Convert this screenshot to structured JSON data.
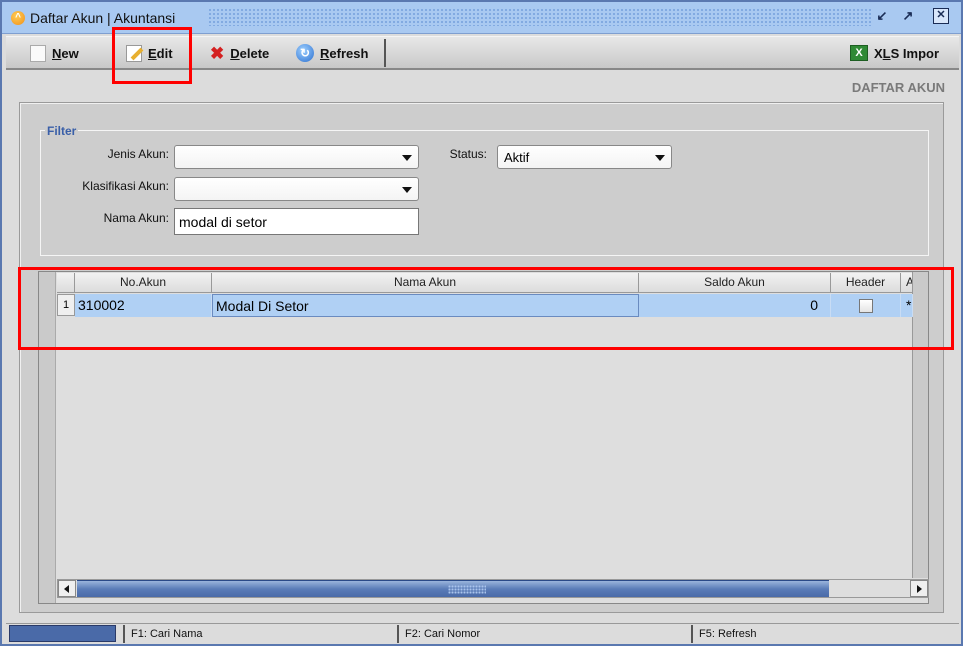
{
  "window": {
    "title": "Daftar Akun | Akuntansi",
    "controls": [
      "restore-down",
      "maximize",
      "close"
    ]
  },
  "toolbar": {
    "new_label": "New",
    "new_mnemonic": "N",
    "edit_label": "Edit",
    "edit_mnemonic": "E",
    "delete_label": "Delete",
    "delete_mnemonic": "D",
    "refresh_label": "Refresh",
    "refresh_mnemonic": "R",
    "xls_label_prefix": "X",
    "xls_mnemonic": "L",
    "xls_label_suffix": "S Impor"
  },
  "section_title": "DAFTAR AKUN",
  "filter": {
    "legend": "Filter",
    "jenis_akun": {
      "label": "Jenis Akun:",
      "value": ""
    },
    "klasifikasi_akun": {
      "label": "Klasifikasi Akun:",
      "value": ""
    },
    "nama_akun": {
      "label": "Nama Akun:",
      "value": "modal di setor"
    },
    "status": {
      "label": "Status:",
      "value": "Aktif"
    }
  },
  "grid": {
    "columns": [
      "No.Akun",
      "Nama Akun",
      "Saldo Akun",
      "Header",
      "Ak"
    ],
    "rows": [
      {
        "row_number": "1",
        "no_akun": "310002",
        "nama_akun": "Modal Di Setor",
        "saldo_akun": "0",
        "header": false,
        "aktif": "*"
      }
    ]
  },
  "statusbar": {
    "f1": "F1: Cari Nama",
    "f2": "F2: Cari Nomor",
    "f5": "F5: Refresh"
  },
  "annotations": {
    "highlight_color": "#ff0000"
  }
}
